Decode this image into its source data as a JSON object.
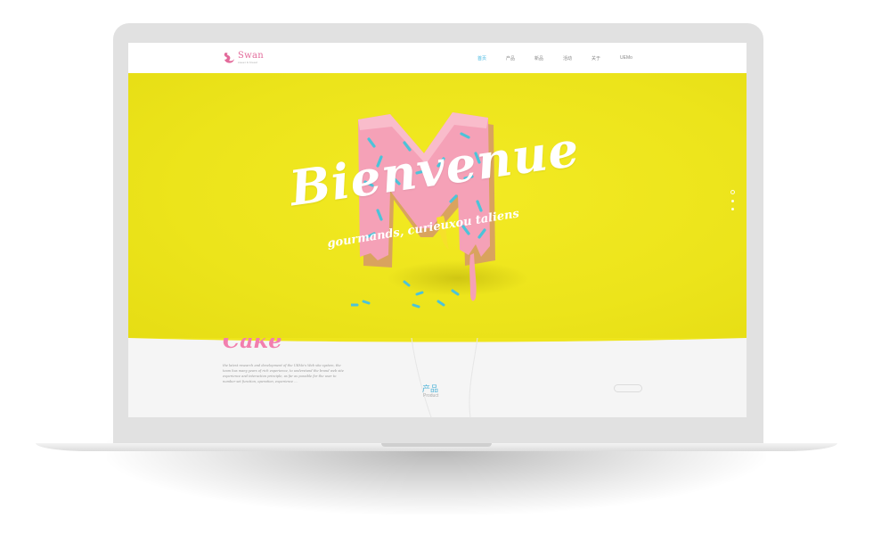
{
  "site": {
    "logo": {
      "name": "Swan",
      "tagline": "sweet & bread"
    },
    "nav": [
      {
        "label": "首页",
        "active": true
      },
      {
        "label": "产品",
        "active": false
      },
      {
        "label": "新品",
        "active": false
      },
      {
        "label": "活动",
        "active": false
      },
      {
        "label": "关于",
        "active": false
      },
      {
        "label": "UEMo",
        "active": false
      }
    ]
  },
  "hero": {
    "title": "Bienvenue",
    "subtitle": "gourmands, curieuxou taliens",
    "background_color": "#eee51c",
    "slides": 3,
    "active_slide": 1
  },
  "lower": {
    "cake_word": "Cake",
    "description": "the latest research and development of the UEMo's Web site system, the team has many years of rich experience, to understand the brand web site experience and interaction principle, as far as possible for the user to number set function, operation, experience ...",
    "product_title": "产品",
    "product_subtitle": "Product"
  },
  "colors": {
    "accent_blue": "#3fb6e0",
    "brand_pink": "#e36b9b",
    "hero_yellow": "#eee51c"
  }
}
